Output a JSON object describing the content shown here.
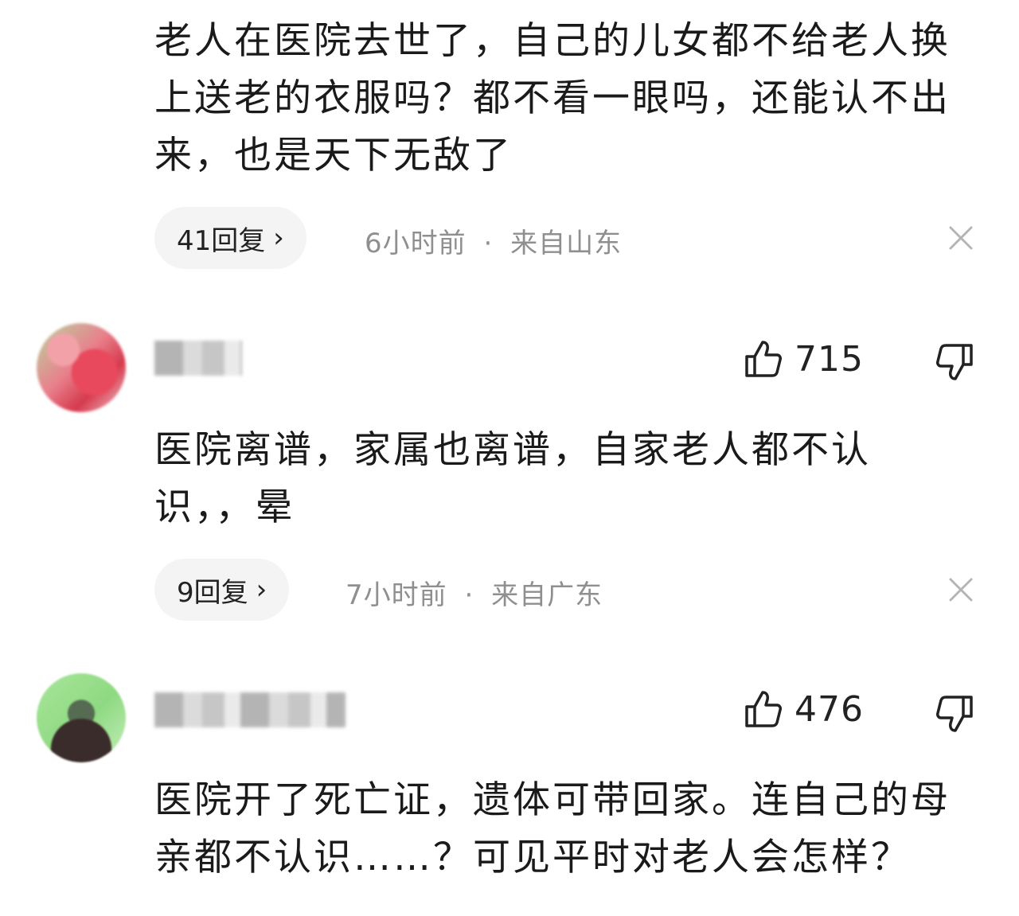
{
  "comments": [
    {
      "text": "老人在医院去世了，自己的儿女都不给老人换上送老的衣服吗？都不看一眼吗，还能认不出来，也是天下无敌了",
      "replies_label": "41回复",
      "time": "6小时前",
      "location": "来自山东"
    },
    {
      "likes": "715",
      "text": "医院离谱，家属也离谱，自家老人都不认识，，晕",
      "replies_label": "9回复",
      "time": "7小时前",
      "location": "来自广东"
    },
    {
      "likes": "476",
      "text": "医院开了死亡证，遗体可带回家。连自己的母亲都不认识……？可见平时对老人会怎样？"
    }
  ],
  "separator": "·",
  "icons": {
    "reply_chevron": "chevron-right-icon",
    "close": "close-icon",
    "like": "thumbs-up-icon",
    "dislike": "thumbs-down-icon"
  }
}
